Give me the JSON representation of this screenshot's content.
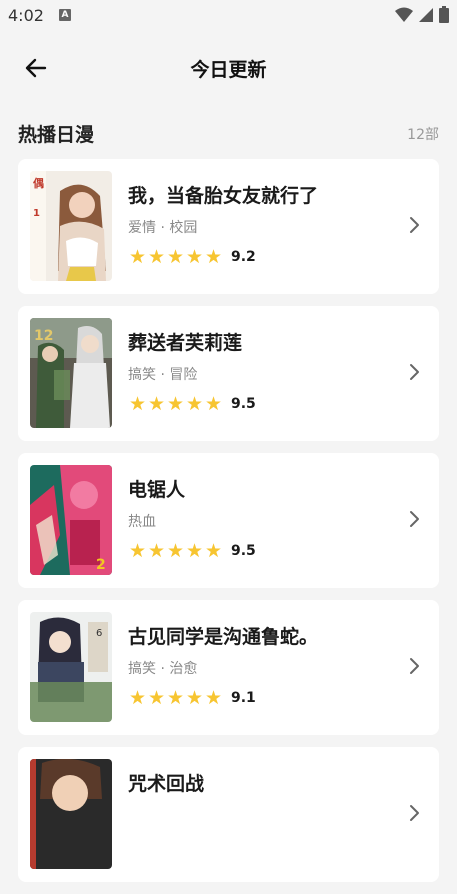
{
  "status_bar": {
    "time": "4:02",
    "notification_icon": "A"
  },
  "header": {
    "title": "今日更新"
  },
  "section": {
    "title": "热播日漫",
    "count": "12部"
  },
  "items": [
    {
      "title": "我，当备胎女友就行了",
      "tags": "爱情 · 校园",
      "rating": "9.2",
      "stars": 5
    },
    {
      "title": "葬送者芙莉莲",
      "tags": "搞笑 · 冒险",
      "rating": "9.5",
      "stars": 5
    },
    {
      "title": "电锯人",
      "tags": "热血",
      "rating": "9.5",
      "stars": 5
    },
    {
      "title": "古见同学是沟通鲁蛇。",
      "tags": "搞笑 · 治愈",
      "rating": "9.1",
      "stars": 5
    },
    {
      "title": "咒术回战",
      "tags": "",
      "rating": "",
      "stars": 0
    }
  ],
  "colors": {
    "star": "#f7c531",
    "background": "#f4f4f4",
    "card": "#ffffff"
  }
}
